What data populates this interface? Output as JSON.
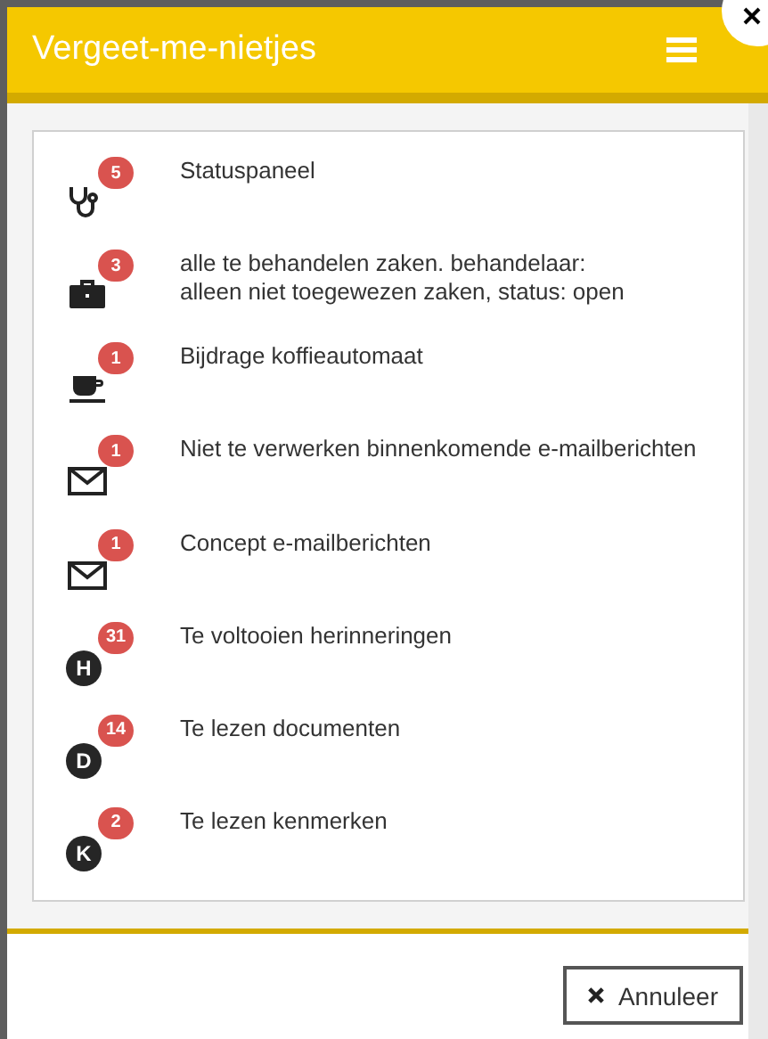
{
  "dialog": {
    "title": "Vergeet-me-nietjes"
  },
  "items": [
    {
      "kind": "icon",
      "count": "5",
      "label": "Statuspaneel"
    },
    {
      "kind": "icon",
      "count": "3",
      "label": "alle te behandelen zaken. behandelaar:\nalleen niet toegewezen zaken, status: open"
    },
    {
      "kind": "icon",
      "count": "1",
      "label": "Bijdrage koffieautomaat"
    },
    {
      "kind": "icon",
      "count": "1",
      "label": "Niet te verwerken binnenkomende e-mailberichten"
    },
    {
      "kind": "icon",
      "count": "1",
      "label": "Concept e-mailberichten"
    },
    {
      "kind": "letter",
      "letter": "H",
      "count": "31",
      "label": "Te voltooien herinneringen"
    },
    {
      "kind": "letter",
      "letter": "D",
      "count": "14",
      "label": "Te lezen documenten"
    },
    {
      "kind": "letter",
      "letter": "K",
      "count": "2",
      "label": "Te lezen kenmerken"
    }
  ],
  "buttons": [
    {
      "label": "Annuleer"
    }
  ]
}
